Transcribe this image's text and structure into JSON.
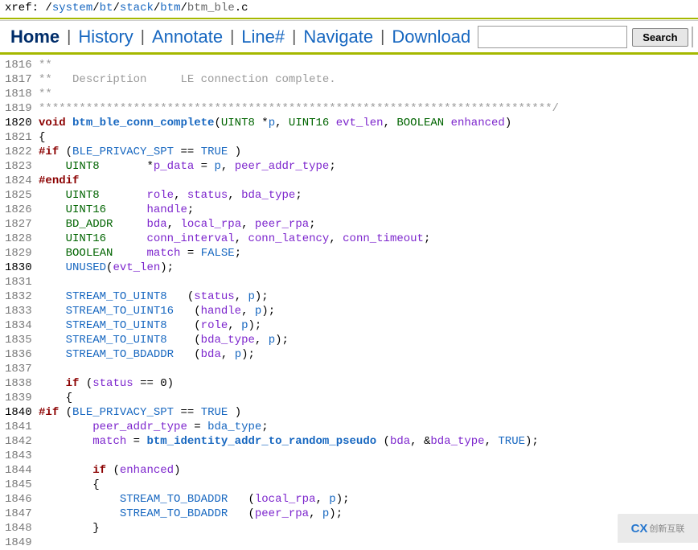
{
  "xref": {
    "label": "xref: ",
    "segs": [
      "/",
      "system",
      "/",
      "bt",
      "/",
      "stack",
      "/",
      "btm",
      "/"
    ],
    "file_stem": "btm_ble",
    "file_ext": ".c"
  },
  "navbar": {
    "home": "Home",
    "history": "History",
    "annotate": "Annotate",
    "line": "Line#",
    "navigate": "Navigate",
    "download": "Download",
    "search_placeholder": "",
    "search_btn": "Search"
  },
  "code": [
    {
      "n": 1816,
      "tokens": [
        [
          "sp",
          " "
        ],
        [
          "c",
          "**"
        ]
      ]
    },
    {
      "n": 1817,
      "tokens": [
        [
          "sp",
          " "
        ],
        [
          "c",
          "**   Description     LE connection complete."
        ]
      ]
    },
    {
      "n": 1818,
      "tokens": [
        [
          "sp",
          " "
        ],
        [
          "c",
          "**"
        ]
      ]
    },
    {
      "n": 1819,
      "tokens": [
        [
          "sp",
          " "
        ],
        [
          "c",
          "****************************************************************************/"
        ]
      ]
    },
    {
      "n": 1820,
      "dark": true,
      "tokens": [
        [
          "sp",
          " "
        ],
        [
          "kw",
          "void"
        ],
        [
          "sp",
          " "
        ],
        [
          "fn",
          "btm_ble_conn_complete"
        ],
        [
          "p",
          "("
        ],
        [
          "ty",
          "UINT8"
        ],
        [
          "sp",
          " *"
        ],
        [
          "id",
          "p"
        ],
        [
          "p",
          ", "
        ],
        [
          "ty",
          "UINT16"
        ],
        [
          "sp",
          " "
        ],
        [
          "var",
          "evt_len"
        ],
        [
          "p",
          ", "
        ],
        [
          "ty",
          "BOOLEAN"
        ],
        [
          "sp",
          " "
        ],
        [
          "var",
          "enhanced"
        ],
        [
          "p",
          ")"
        ]
      ]
    },
    {
      "n": 1821,
      "tokens": [
        [
          "sp",
          " "
        ],
        [
          "p",
          "{"
        ]
      ]
    },
    {
      "n": 1822,
      "tokens": [
        [
          "sp",
          " "
        ],
        [
          "pp",
          "#if"
        ],
        [
          "sp",
          " ("
        ],
        [
          "id",
          "BLE_PRIVACY_SPT"
        ],
        [
          "sp",
          " == "
        ],
        [
          "id",
          "TRUE"
        ],
        [
          "sp",
          " )"
        ]
      ]
    },
    {
      "n": 1823,
      "tokens": [
        [
          "sp",
          "     "
        ],
        [
          "ty",
          "UINT8"
        ],
        [
          "sp",
          "       *"
        ],
        [
          "var",
          "p_data"
        ],
        [
          "sp",
          " = "
        ],
        [
          "id",
          "p"
        ],
        [
          "p",
          ", "
        ],
        [
          "var",
          "peer_addr_type"
        ],
        [
          "p",
          ";"
        ]
      ]
    },
    {
      "n": 1824,
      "tokens": [
        [
          "sp",
          " "
        ],
        [
          "pp",
          "#endif"
        ]
      ]
    },
    {
      "n": 1825,
      "tokens": [
        [
          "sp",
          "     "
        ],
        [
          "ty",
          "UINT8"
        ],
        [
          "sp",
          "       "
        ],
        [
          "var",
          "role"
        ],
        [
          "p",
          ", "
        ],
        [
          "var",
          "status"
        ],
        [
          "p",
          ", "
        ],
        [
          "var",
          "bda_type"
        ],
        [
          "p",
          ";"
        ]
      ]
    },
    {
      "n": 1826,
      "tokens": [
        [
          "sp",
          "     "
        ],
        [
          "ty",
          "UINT16"
        ],
        [
          "sp",
          "      "
        ],
        [
          "var",
          "handle"
        ],
        [
          "p",
          ";"
        ]
      ]
    },
    {
      "n": 1827,
      "tokens": [
        [
          "sp",
          "     "
        ],
        [
          "ty",
          "BD_ADDR"
        ],
        [
          "sp",
          "     "
        ],
        [
          "var",
          "bda"
        ],
        [
          "p",
          ", "
        ],
        [
          "var",
          "local_rpa"
        ],
        [
          "p",
          ", "
        ],
        [
          "var",
          "peer_rpa"
        ],
        [
          "p",
          ";"
        ]
      ]
    },
    {
      "n": 1828,
      "tokens": [
        [
          "sp",
          "     "
        ],
        [
          "ty",
          "UINT16"
        ],
        [
          "sp",
          "      "
        ],
        [
          "var",
          "conn_interval"
        ],
        [
          "p",
          ", "
        ],
        [
          "var",
          "conn_latency"
        ],
        [
          "p",
          ", "
        ],
        [
          "var",
          "conn_timeout"
        ],
        [
          "p",
          ";"
        ]
      ]
    },
    {
      "n": 1829,
      "tokens": [
        [
          "sp",
          "     "
        ],
        [
          "ty",
          "BOOLEAN"
        ],
        [
          "sp",
          "     "
        ],
        [
          "var",
          "match"
        ],
        [
          "sp",
          " = "
        ],
        [
          "id",
          "FALSE"
        ],
        [
          "p",
          ";"
        ]
      ]
    },
    {
      "n": 1830,
      "dark": true,
      "tokens": [
        [
          "sp",
          "     "
        ],
        [
          "id",
          "UNUSED"
        ],
        [
          "p",
          "("
        ],
        [
          "var",
          "evt_len"
        ],
        [
          "p",
          ");"
        ]
      ]
    },
    {
      "n": 1831,
      "tokens": []
    },
    {
      "n": 1832,
      "tokens": [
        [
          "sp",
          "     "
        ],
        [
          "id",
          "STREAM_TO_UINT8"
        ],
        [
          "sp",
          "   ("
        ],
        [
          "var",
          "status"
        ],
        [
          "p",
          ", "
        ],
        [
          "id",
          "p"
        ],
        [
          "p",
          ");"
        ]
      ]
    },
    {
      "n": 1833,
      "tokens": [
        [
          "sp",
          "     "
        ],
        [
          "id",
          "STREAM_TO_UINT16"
        ],
        [
          "sp",
          "   ("
        ],
        [
          "var",
          "handle"
        ],
        [
          "p",
          ", "
        ],
        [
          "id",
          "p"
        ],
        [
          "p",
          ");"
        ]
      ]
    },
    {
      "n": 1834,
      "tokens": [
        [
          "sp",
          "     "
        ],
        [
          "id",
          "STREAM_TO_UINT8"
        ],
        [
          "sp",
          "    ("
        ],
        [
          "var",
          "role"
        ],
        [
          "p",
          ", "
        ],
        [
          "id",
          "p"
        ],
        [
          "p",
          ");"
        ]
      ]
    },
    {
      "n": 1835,
      "tokens": [
        [
          "sp",
          "     "
        ],
        [
          "id",
          "STREAM_TO_UINT8"
        ],
        [
          "sp",
          "    ("
        ],
        [
          "var",
          "bda_type"
        ],
        [
          "p",
          ", "
        ],
        [
          "id",
          "p"
        ],
        [
          "p",
          ");"
        ]
      ]
    },
    {
      "n": 1836,
      "tokens": [
        [
          "sp",
          "     "
        ],
        [
          "id",
          "STREAM_TO_BDADDR"
        ],
        [
          "sp",
          "   ("
        ],
        [
          "var",
          "bda"
        ],
        [
          "p",
          ", "
        ],
        [
          "id",
          "p"
        ],
        [
          "p",
          ");"
        ]
      ]
    },
    {
      "n": 1837,
      "tokens": []
    },
    {
      "n": 1838,
      "tokens": [
        [
          "sp",
          "     "
        ],
        [
          "kw",
          "if"
        ],
        [
          "sp",
          " ("
        ],
        [
          "var",
          "status"
        ],
        [
          "sp",
          " == 0)"
        ]
      ]
    },
    {
      "n": 1839,
      "tokens": [
        [
          "sp",
          "     {"
        ]
      ]
    },
    {
      "n": 1840,
      "dark": true,
      "tokens": [
        [
          "sp",
          " "
        ],
        [
          "pp",
          "#if"
        ],
        [
          "sp",
          " ("
        ],
        [
          "id",
          "BLE_PRIVACY_SPT"
        ],
        [
          "sp",
          " == "
        ],
        [
          "id",
          "TRUE"
        ],
        [
          "sp",
          " )"
        ]
      ]
    },
    {
      "n": 1841,
      "tokens": [
        [
          "sp",
          "         "
        ],
        [
          "var",
          "peer_addr_type"
        ],
        [
          "sp",
          " = "
        ],
        [
          "id",
          "bda_type"
        ],
        [
          "p",
          ";"
        ]
      ]
    },
    {
      "n": 1842,
      "tokens": [
        [
          "sp",
          "         "
        ],
        [
          "var",
          "match"
        ],
        [
          "sp",
          " = "
        ],
        [
          "fn",
          "btm_identity_addr_to_random_pseudo"
        ],
        [
          "sp",
          " ("
        ],
        [
          "var",
          "bda"
        ],
        [
          "p",
          ", &"
        ],
        [
          "var",
          "bda_type"
        ],
        [
          "p",
          ", "
        ],
        [
          "id",
          "TRUE"
        ],
        [
          "p",
          ");"
        ]
      ]
    },
    {
      "n": 1843,
      "tokens": []
    },
    {
      "n": 1844,
      "tokens": [
        [
          "sp",
          "         "
        ],
        [
          "kw",
          "if"
        ],
        [
          "sp",
          " ("
        ],
        [
          "var",
          "enhanced"
        ],
        [
          "p",
          ")"
        ]
      ]
    },
    {
      "n": 1845,
      "tokens": [
        [
          "sp",
          "         {"
        ]
      ]
    },
    {
      "n": 1846,
      "tokens": [
        [
          "sp",
          "             "
        ],
        [
          "id",
          "STREAM_TO_BDADDR"
        ],
        [
          "sp",
          "   ("
        ],
        [
          "var",
          "local_rpa"
        ],
        [
          "p",
          ", "
        ],
        [
          "id",
          "p"
        ],
        [
          "p",
          ");"
        ]
      ]
    },
    {
      "n": 1847,
      "tokens": [
        [
          "sp",
          "             "
        ],
        [
          "id",
          "STREAM_TO_BDADDR"
        ],
        [
          "sp",
          "   ("
        ],
        [
          "var",
          "peer_rpa"
        ],
        [
          "p",
          ", "
        ],
        [
          "id",
          "p"
        ],
        [
          "p",
          ");"
        ]
      ]
    },
    {
      "n": 1848,
      "tokens": [
        [
          "sp",
          "         }"
        ]
      ]
    },
    {
      "n": 1849,
      "tokens": []
    }
  ],
  "watermark": {
    "left": "CX",
    "right": "创新互联"
  }
}
